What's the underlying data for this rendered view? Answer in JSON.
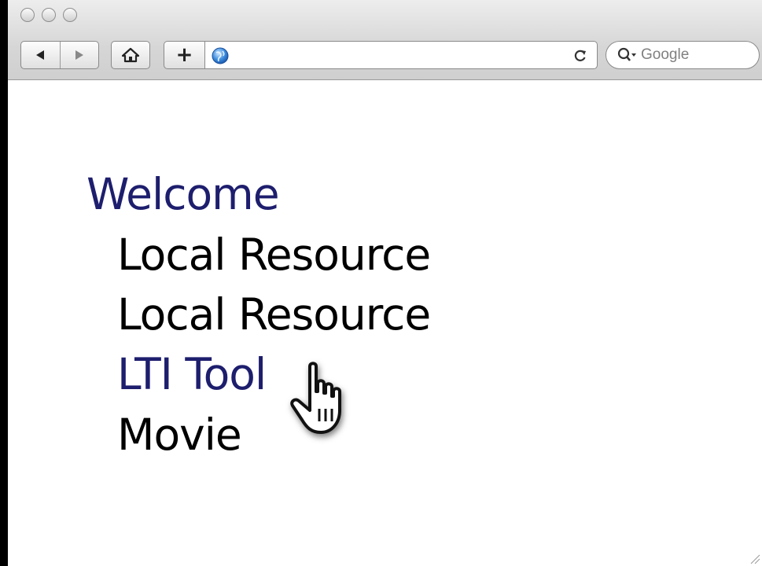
{
  "toolbar": {
    "back_icon": "back-arrow-icon",
    "forward_icon": "forward-arrow-icon",
    "home_icon": "home-icon",
    "add_icon": "plus-icon",
    "reload_icon": "reload-icon",
    "add_label": "+",
    "address_value": ""
  },
  "search": {
    "placeholder": "Google"
  },
  "nav": {
    "items": [
      {
        "label": "Welcome",
        "link": true
      },
      {
        "label": "Local Resource",
        "link": false
      },
      {
        "label": "Local Resource",
        "link": false
      },
      {
        "label": "LTI Tool",
        "link": true
      },
      {
        "label": "Movie",
        "link": false
      }
    ]
  },
  "colors": {
    "link": "#1e1e6e",
    "text": "#000000",
    "background": "#ffffff"
  }
}
